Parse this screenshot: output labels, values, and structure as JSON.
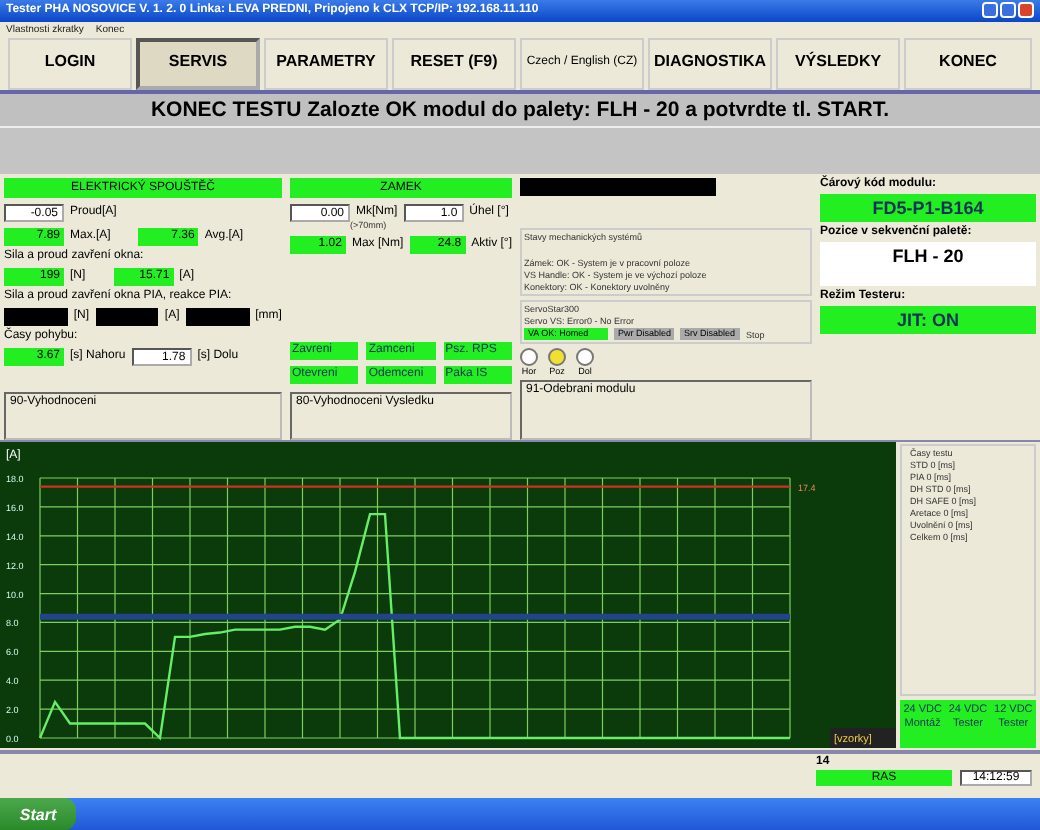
{
  "window": {
    "title": "Tester PHA NOSOVICE  V. 1. 2. 0  Linka: LEVA PREDNI, Pripojeno k CLX TCP/IP: 192.168.11.110"
  },
  "menu": [
    "Vlastnosti zkratky",
    "Konec"
  ],
  "toolbar": [
    {
      "label": "LOGIN",
      "selected": false
    },
    {
      "label": "SERVIS",
      "selected": true
    },
    {
      "label": "PARAMETRY",
      "selected": false
    },
    {
      "label": "RESET (F9)",
      "selected": false
    },
    {
      "label": "Czech / English (CZ)",
      "selected": false
    },
    {
      "label": "DIAGNOSTIKA",
      "selected": false
    },
    {
      "label": "VÝSLEDKY",
      "selected": false
    },
    {
      "label": "KONEC",
      "selected": false
    }
  ],
  "banner": "KONEC TESTU Zalozte OK modul do palety: FLH - 20 a potvrdte tl. START.",
  "starter": {
    "header": "ELEKTRICKÝ SPOUŠTĚČ",
    "current": {
      "value": "-0.05",
      "unit": "Proud[A]",
      "kind": "plain"
    },
    "max": {
      "value": "7.89",
      "unit": "Max.[A]",
      "kind": "lit"
    },
    "avg": {
      "value": "7.36",
      "unit": "Avg.[A]",
      "kind": "lit"
    },
    "close_label": "Sila a proud zavření okna:",
    "close": [
      {
        "value": "199",
        "unit": "[N]",
        "kind": "lit"
      },
      {
        "value": "15.71",
        "unit": "[A]",
        "kind": "lit"
      }
    ],
    "pia_label": "Sila a proud zavření okna PIA, reakce PIA:",
    "pia": [
      {
        "unit": "[N]",
        "kind": "dark"
      },
      {
        "unit": "[A]",
        "kind": "dark"
      },
      {
        "unit": "[mm]",
        "kind": "dark"
      }
    ],
    "times_label": "Časy pohybu:",
    "times": [
      {
        "value": "3.67",
        "unit": "[s] Nahoru",
        "kind": "lit"
      },
      {
        "value": "1.78",
        "unit": "[s] Dolu",
        "kind": "plain"
      }
    ],
    "result": "90-Vyhodnoceni"
  },
  "lock": {
    "header": "ZAMEK",
    "torque": {
      "value": "0.00",
      "unit": "Mk[Nm]",
      "note": "(>70mm)",
      "kind": "plain"
    },
    "angle": {
      "value": "1.0",
      "unit": "Úhel [°]",
      "kind": "plain"
    },
    "max": {
      "value": "1.02",
      "unit": "Max [Nm]",
      "kind": "lit"
    },
    "active": {
      "value": "24.8",
      "unit": "Aktiv [°]",
      "kind": "lit"
    },
    "indicators": [
      "Zavreni",
      "Zamceni",
      "Psz. RPS",
      "Otevreni",
      "Odemceni",
      "Paka IS"
    ],
    "result": "80-Vyhodnoceni Vysledku"
  },
  "systems": {
    "title": "Stavy mechanických systémů",
    "lines": [
      "Zámek: OK - System je v pracovní poloze",
      "VS Handle: OK - System je ve výchozí poloze"
    ],
    "connectors": "Konektory: OK - Konektory uvolněny",
    "servo_title": "ServoStar300",
    "servo_status": "Servo VS: Error0 - No Error",
    "flags": [
      {
        "label": "VA OK: Homed",
        "on": true
      },
      {
        "label": "Pwr Disabled",
        "on": false
      },
      {
        "label": "Srv Disabled",
        "on": false
      }
    ],
    "stop": "Stop",
    "positions": [
      {
        "label": "Hor",
        "selected": false
      },
      {
        "label": "Poz",
        "selected": true
      },
      {
        "label": "Dol",
        "selected": false
      }
    ],
    "result": "91-Odebrani modulu"
  },
  "module": {
    "barcode_label": "Čárový kód modulu:",
    "barcode": "FD5-P1-B164",
    "position_label": "Pozice v sekvenční paletě:",
    "position": "FLH - 20",
    "mode_label": "Režim Testeru:",
    "mode": "JIT: ON"
  },
  "graph": {
    "limit_label": "17.4",
    "chart_data": {
      "type": "line",
      "ylabel": "[A]",
      "xlabel": "[vzorky]",
      "grid": true,
      "ylim": [
        0,
        18
      ],
      "yticks": [
        {
          "value": 0,
          "label": "0.0"
        },
        {
          "value": 2,
          "label": "2.0"
        },
        {
          "value": 4,
          "label": "4.0"
        },
        {
          "value": 6,
          "label": "6.0"
        },
        {
          "value": 8,
          "label": "8.0"
        },
        {
          "value": 10,
          "label": "10.0"
        },
        {
          "value": 12,
          "label": "12.0"
        },
        {
          "value": 14,
          "label": "14.0"
        },
        {
          "value": 16,
          "label": "16.0"
        },
        {
          "value": 18,
          "label": "18.0"
        }
      ],
      "series": [
        {
          "color": "#66ee66",
          "values": [
            0,
            2.5,
            1,
            1,
            1,
            1,
            1,
            1,
            0,
            7,
            7,
            7.2,
            7.3,
            7.5,
            7.5,
            7.5,
            7.5,
            7.7,
            7.7,
            7.5,
            8.2,
            11.5,
            15.5,
            15.5,
            0,
            0,
            0,
            0,
            0,
            0,
            0,
            0,
            0,
            0,
            0,
            0,
            0,
            0,
            0,
            0,
            0,
            0,
            0,
            0,
            0,
            0,
            0,
            0,
            0,
            0,
            0
          ]
        },
        {
          "color": "#cc3322",
          "values": [
            17.4,
            17.4,
            17.4,
            17.4,
            17.4,
            17.4,
            17.4,
            17.4,
            17.4,
            17.4,
            17.4,
            17.4,
            17.4,
            17.4,
            17.4,
            17.4,
            17.4,
            17.4,
            17.4,
            17.4,
            17.4,
            17.4,
            17.4,
            17.4,
            17.4,
            17.4,
            17.4,
            17.4,
            17.4,
            17.4,
            17.4,
            17.4,
            17.4,
            17.4,
            17.4,
            17.4,
            17.4,
            17.4,
            17.4,
            17.4,
            17.4,
            17.4,
            17.4,
            17.4,
            17.4,
            17.4,
            17.4,
            17.4,
            17.4,
            17.4,
            17.4
          ]
        },
        {
          "color": "#224488",
          "values": [
            8.4,
            8.4,
            8.4,
            8.4,
            8.4,
            8.4,
            8.4,
            8.4,
            8.4,
            8.4,
            8.4,
            8.4,
            8.4,
            8.4,
            8.4,
            8.4,
            8.4,
            8.4,
            8.4,
            8.4,
            8.4,
            8.4,
            8.4,
            8.4,
            8.4,
            8.4,
            8.4,
            8.4,
            8.4,
            8.4,
            8.4,
            8.4,
            8.4,
            8.4,
            8.4,
            8.4,
            8.4,
            8.4,
            8.4,
            8.4,
            8.4,
            8.4,
            8.4,
            8.4,
            8.4,
            8.4,
            8.4,
            8.4,
            8.4,
            8.4,
            8.4
          ]
        }
      ]
    }
  },
  "test_times": {
    "title": "Časy testu",
    "items": [
      "STD 0 [ms]",
      "PIA 0 [ms]",
      "DH STD 0 [ms]",
      "DH SAFE 0 [ms]",
      "Aretace 0 [ms]",
      "Uvolnění 0 [ms]",
      "Celkem 0 [ms]"
    ]
  },
  "supplies": [
    {
      "voltage": "24 VDC",
      "label": "Montáž",
      "on": true
    },
    {
      "voltage": "24 VDC",
      "label": "Tester",
      "on": true
    },
    {
      "voltage": "12 VDC",
      "label": "Tester",
      "on": true
    }
  ],
  "status_bar": {
    "count": "14",
    "state": "RAS",
    "time": "14:12:59"
  },
  "taskbar": {
    "start": "Start"
  }
}
